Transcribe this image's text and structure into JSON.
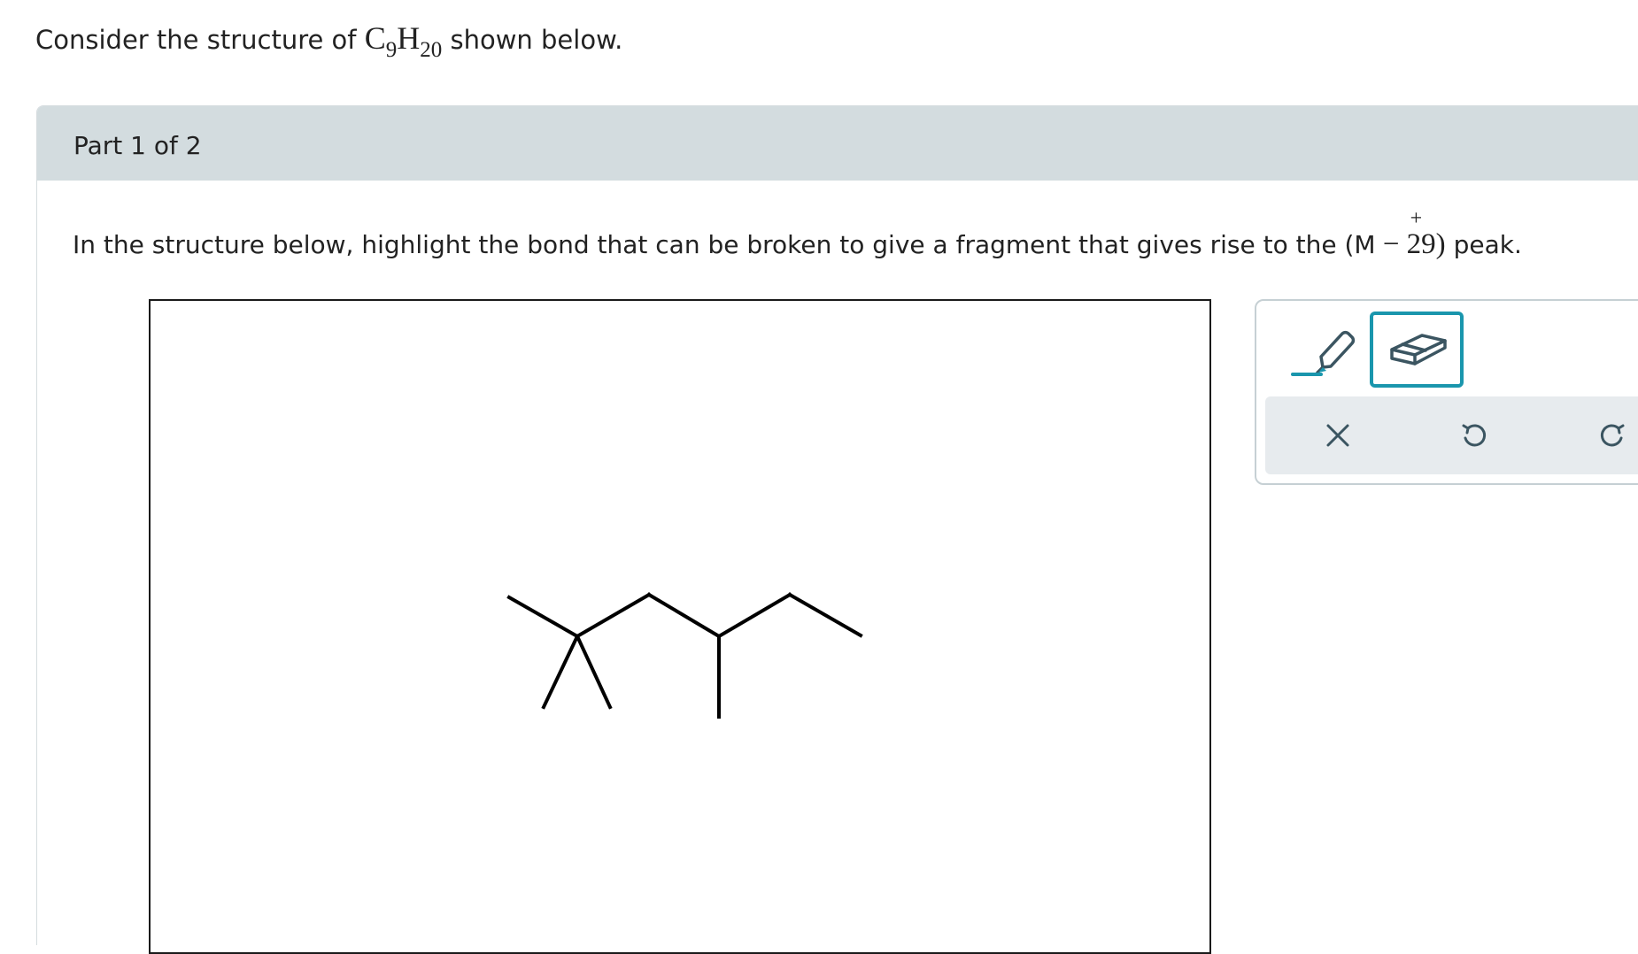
{
  "prompt": {
    "text_before": "Consider the structure of ",
    "c_symbol": "C",
    "c_count": "9",
    "h_symbol": "H",
    "h_count": "20",
    "text_after": " shown below."
  },
  "part": {
    "label": "Part 1 of 2"
  },
  "question": {
    "text_before": "In the structure below, highlight the bond that can be broken to give a fragment that gives rise to the (M",
    "ion_charge": "+",
    "peak_math": " − 29)",
    "text_after": " peak."
  },
  "tools": {
    "highlight": {
      "icon": "highlighter-icon",
      "selected": false
    },
    "eraser": {
      "icon": "eraser-icon",
      "selected": true
    },
    "clear": {
      "icon": "close-icon"
    },
    "undo": {
      "icon": "undo-icon"
    },
    "redo": {
      "icon": "redo-icon"
    }
  },
  "colors": {
    "accent": "#1a96ad",
    "header_bg": "#d3dcdf",
    "toolbar_bg": "#e7ebee",
    "icon": "#3b5561"
  }
}
